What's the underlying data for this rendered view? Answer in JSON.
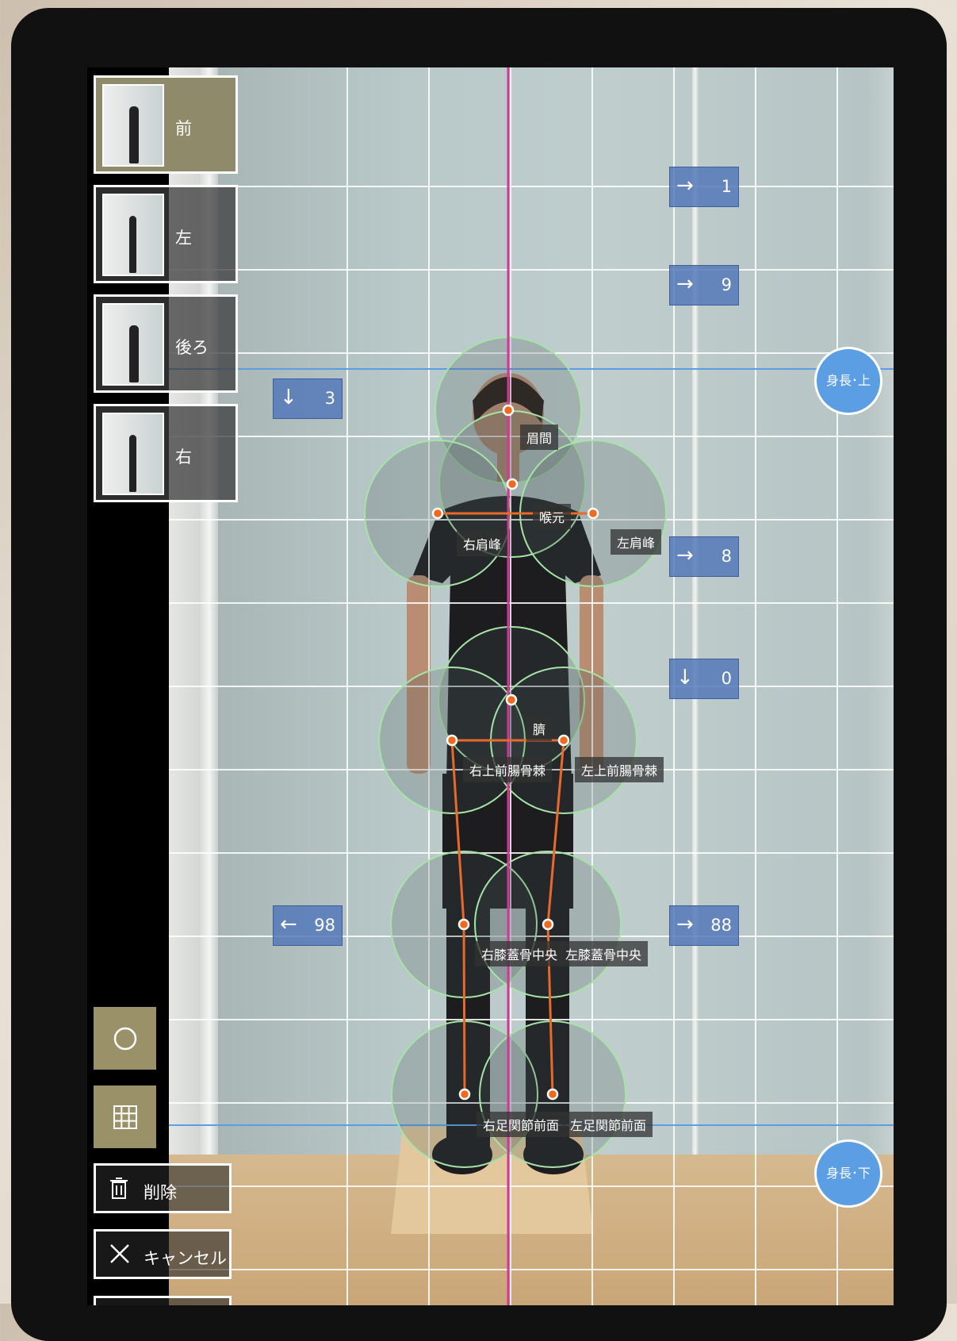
{
  "views": [
    {
      "label": "前",
      "active": true
    },
    {
      "label": "左",
      "active": false
    },
    {
      "label": "後ろ",
      "active": false
    },
    {
      "label": "右",
      "active": false
    }
  ],
  "tools": {
    "circle_icon": "circle-icon",
    "grid_icon": "grid-icon"
  },
  "actions": {
    "delete_label": "削除",
    "cancel_label": "キャンセル"
  },
  "nav_boxes": {
    "top_right_1": {
      "arrow": "→",
      "value": "1"
    },
    "top_right_2": {
      "arrow": "→",
      "value": "9"
    },
    "left_top": {
      "arrow": "↓",
      "value": "3"
    },
    "right_mid": {
      "arrow": "→",
      "value": "8"
    },
    "right_down": {
      "arrow": "↓",
      "value": "0"
    },
    "left_bottom": {
      "arrow": "←",
      "value": "98"
    },
    "right_bottom": {
      "arrow": "→",
      "value": "88"
    }
  },
  "height_markers": {
    "top": "身長･上",
    "bottom": "身長･下"
  },
  "landmarks": {
    "glabella": "眉間",
    "throat": "喉元",
    "right_acromion": "右肩峰",
    "left_acromion": "左肩峰",
    "navel": "臍",
    "right_asis": "右上前腸骨棘",
    "left_asis": "左上前腸骨棘",
    "right_patella": "右膝蓋骨中央",
    "left_patella": "左膝蓋骨中央",
    "right_ankle": "右足関節前面",
    "left_ankle": "左足関節前面"
  },
  "colors": {
    "accent": "#9b9168",
    "nav_blue": "#5479b8",
    "center_line": "#d6369a",
    "landmark_line": "#e8692a",
    "circle": "#a6e4a6"
  }
}
